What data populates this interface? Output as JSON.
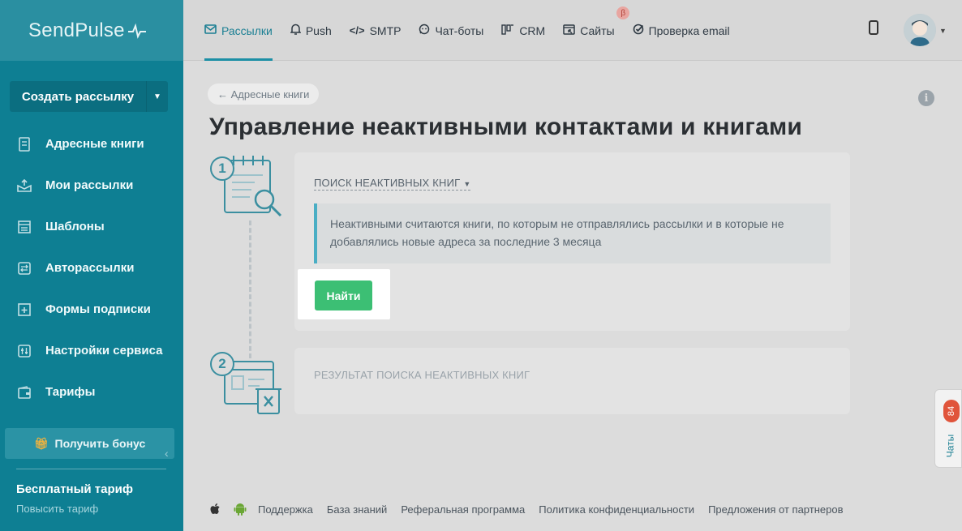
{
  "app": {
    "logo_text": "SendPulse"
  },
  "sidebar": {
    "create_button": "Создать рассылку",
    "items": [
      {
        "label": "Адресные книги",
        "icon": "address-book-icon"
      },
      {
        "label": "Мои рассылки",
        "icon": "mailings-icon"
      },
      {
        "label": "Шаблоны",
        "icon": "templates-icon"
      },
      {
        "label": "Авторассылки",
        "icon": "automation-icon"
      },
      {
        "label": "Формы подписки",
        "icon": "subscription-form-icon"
      },
      {
        "label": "Настройки сервиса",
        "icon": "settings-icon"
      },
      {
        "label": "Тарифы",
        "icon": "wallet-icon"
      }
    ],
    "bonus_button": "Получить бонус",
    "plan_title": "Бесплатный тариф",
    "plan_link": "Повысить тариф"
  },
  "topbar": {
    "tabs": [
      {
        "label": "Рассылки",
        "icon": "envelope-icon",
        "active": true
      },
      {
        "label": "Push",
        "icon": "bell-icon"
      },
      {
        "label": "SMTP",
        "icon": "code-icon"
      },
      {
        "label": "Чат-боты",
        "icon": "chatbot-icon"
      },
      {
        "label": "CRM",
        "icon": "crm-icon"
      },
      {
        "label": "Сайты",
        "icon": "sites-icon",
        "badge": "β"
      },
      {
        "label": "Проверка email",
        "icon": "check-circle-icon"
      }
    ]
  },
  "main": {
    "back_label": "← Адресные книги",
    "title": "Управление неактивными контактами и книгами",
    "step1": {
      "number": "1",
      "section_label": "ПОИСК НЕАКТИВНЫХ КНИГ",
      "note": "Неактивными считаются книги, по которым не отправлялись рассылки и в которые не добавлялись новые адреса за последние 3 месяца",
      "find_button": "Найти"
    },
    "step2": {
      "number": "2",
      "section_label": "РЕЗУЛЬТАТ ПОИСКА НЕАКТИВНЫХ КНИГ"
    }
  },
  "chat_widget": {
    "label": "Чаты",
    "count": "84"
  },
  "footer": {
    "links": [
      "Поддержка",
      "База знаний",
      "Реферальная программа",
      "Политика конфиденциальности",
      "Предложения от партнеров"
    ]
  },
  "colors": {
    "sidebar": "#0e7f93",
    "accent": "#1b8fa5",
    "find_button": "#3cbf74"
  }
}
